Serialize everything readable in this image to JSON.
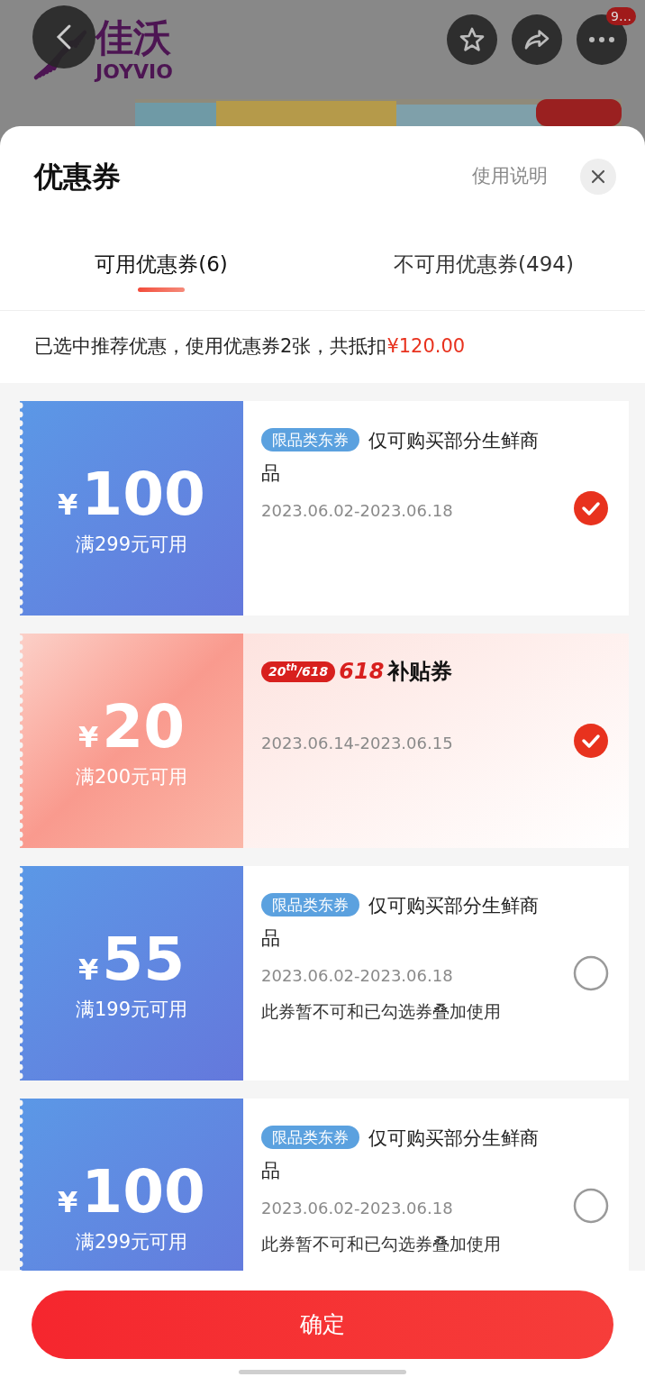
{
  "top_bar": {
    "logo_cn": "佳沃",
    "logo_en": "JOYVIO",
    "more_badge": "9…"
  },
  "sheet": {
    "title": "优惠券",
    "help_link": "使用说明"
  },
  "tabs": [
    {
      "label": "可用优惠券(6)",
      "selected": true
    },
    {
      "label": "不可用优惠券(494)",
      "selected": false
    }
  ],
  "summary": {
    "text": "已选中推荐优惠，使用优惠券2张，共抵扣",
    "amount": "¥120.00"
  },
  "coupons": [
    {
      "kind": "category",
      "currency": "¥",
      "amount": "100",
      "condition": "满299元可用",
      "tag": "限品类东券",
      "title": "仅可购买部分生鲜商品",
      "date": "2023.06.02-2023.06.18",
      "selected": true
    },
    {
      "kind": "subsidy",
      "currency": "¥",
      "amount": "20",
      "condition": "满200元可用",
      "tag": "20$^{th}$/618",
      "title_number": "618",
      "title": "补贴券",
      "date": "2023.06.14-2023.06.15",
      "selected": true
    },
    {
      "kind": "category",
      "currency": "¥",
      "amount": "55",
      "condition": "满199元可用",
      "tag": "限品类东券",
      "title": "仅可购买部分生鲜商品",
      "date": "2023.06.02-2023.06.18",
      "note": "此券暂不可和已勾选券叠加使用",
      "selected": false
    },
    {
      "kind": "category",
      "currency": "¥",
      "amount": "100",
      "condition": "满299元可用",
      "tag": "限品类东券",
      "title": "仅可购买部分生鲜商品",
      "date": "2023.06.02-2023.06.18",
      "note": "此券暂不可和已勾选券叠加使用",
      "selected": false
    }
  ],
  "confirm_button": "确定"
}
